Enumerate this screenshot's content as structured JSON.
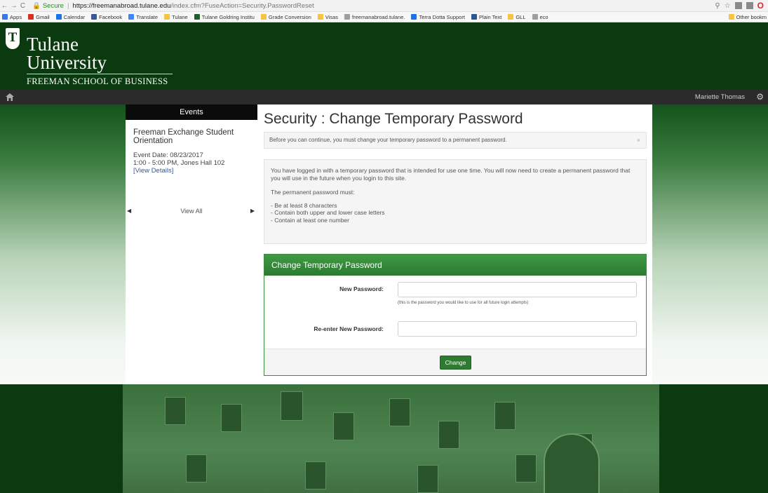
{
  "browser": {
    "secure_label": "Secure",
    "url_host": "https://freemanabroad.tulane.edu",
    "url_path": "/index.cfm?FuseAction=Security.PasswordReset",
    "bookmarks": [
      {
        "label": "Apps",
        "color": "#3b78e7"
      },
      {
        "label": "Gmail",
        "color": "#d93025"
      },
      {
        "label": "Calendar",
        "color": "#1a73e8"
      },
      {
        "label": "Facebook",
        "color": "#3b5998"
      },
      {
        "label": "Translate",
        "color": "#4285f4"
      },
      {
        "label": "Tulane",
        "color": "#f4c542"
      },
      {
        "label": "Tulane Goldring Institu",
        "color": "#1f5e2a"
      },
      {
        "label": "Grade Conversion",
        "color": "#f4c542"
      },
      {
        "label": "Visas",
        "color": "#f4c542"
      },
      {
        "label": "freemanabroad.tulane.",
        "color": "#9e9e9e"
      },
      {
        "label": "Terra Dotta Support",
        "color": "#1a73e8"
      },
      {
        "label": "Plain Text",
        "color": "#2b5797"
      },
      {
        "label": "GLL",
        "color": "#f4c542"
      },
      {
        "label": "eco",
        "color": "#9e9e9e"
      }
    ],
    "other_bookmarks": "Other bookm"
  },
  "header": {
    "logo_line1": "Tulane",
    "logo_line2": "University",
    "logo_line3": "FREEMAN SCHOOL OF BUSINESS"
  },
  "topnav": {
    "user_name": "Mariette Thomas"
  },
  "sidebar": {
    "heading": "Events",
    "event_title": "Freeman Exchange Student Orientation",
    "event_date": "Event Date: 08/23/2017",
    "event_time": "1:00 - 5:00 PM, Jones Hall 102",
    "event_link": "[View Details]",
    "view_all": "View All"
  },
  "main": {
    "title": "Security : Change Temporary Password",
    "alert": "Before you can continue, you must change your temporary password to a permanent password.",
    "alert_close": "×",
    "info_p1": "You have logged in with a temporary password that is intended for use one time. You will now need to create a permanent password that you will use in the future when you login to this site.",
    "info_p2": "The permanent password must:",
    "rules": [
      "- Be at least 8 characters",
      "- Contain both upper and lower case letters",
      "- Contain at least one number"
    ],
    "card_title": "Change Temporary Password",
    "new_password_label": "New Password:",
    "new_password_help": "(this is the password you would like to use for all future login attempts)",
    "reenter_label": "Re-enter New Password:",
    "submit_label": "Change"
  }
}
